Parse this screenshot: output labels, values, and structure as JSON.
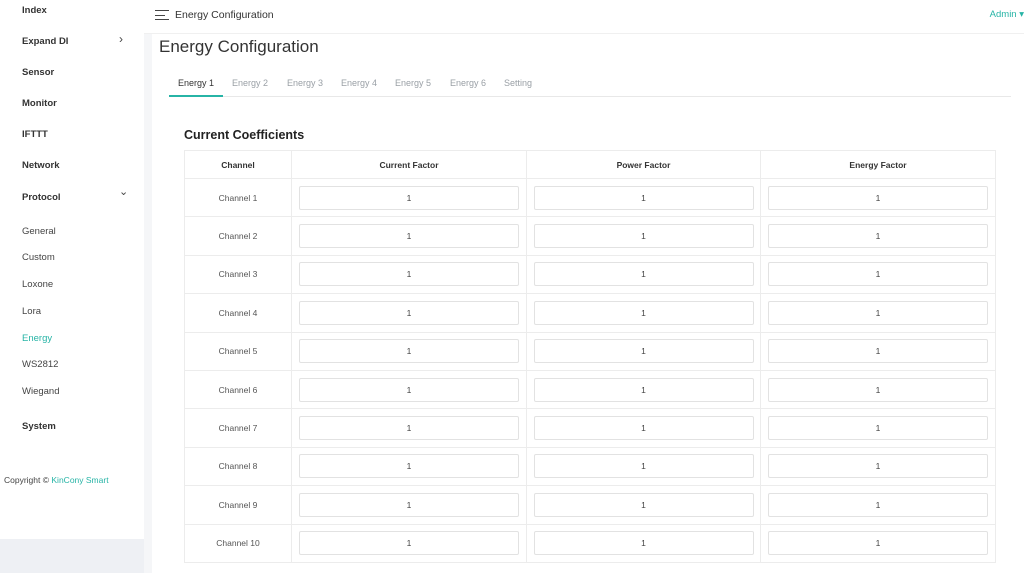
{
  "sidebar": {
    "items": [
      {
        "label": "Index"
      },
      {
        "label": "Expand DI",
        "chevron": "›"
      },
      {
        "label": "Sensor"
      },
      {
        "label": "Monitor"
      },
      {
        "label": "IFTTT"
      },
      {
        "label": "Network"
      },
      {
        "label": "Protocol",
        "chevron": "⌄"
      }
    ],
    "protocol_sub": [
      {
        "label": "General"
      },
      {
        "label": "Custom"
      },
      {
        "label": "Loxone"
      },
      {
        "label": "Lora"
      },
      {
        "label": "Energy",
        "active": true
      },
      {
        "label": "WS2812"
      },
      {
        "label": "Wiegand"
      }
    ],
    "system_label": "System",
    "copyright_prefix": "Copyright ©",
    "copyright_brand": "KinCony Smart"
  },
  "header": {
    "title": "Energy Configuration",
    "user": "Admin ▾"
  },
  "main": {
    "page_title": "Energy Configuration",
    "tabs": [
      {
        "label": "Energy 1",
        "active": true
      },
      {
        "label": "Energy 2"
      },
      {
        "label": "Energy 3"
      },
      {
        "label": "Energy 4"
      },
      {
        "label": "Energy 5"
      },
      {
        "label": "Energy 6"
      },
      {
        "label": "Setting"
      }
    ],
    "section_title": "Current Coefficients",
    "table": {
      "headers": [
        "Channel",
        "Current Factor",
        "Power Factor",
        "Energy Factor"
      ],
      "rows": [
        {
          "channel": "Channel 1",
          "current": "1",
          "power": "1",
          "energy": "1"
        },
        {
          "channel": "Channel 2",
          "current": "1",
          "power": "1",
          "energy": "1"
        },
        {
          "channel": "Channel 3",
          "current": "1",
          "power": "1",
          "energy": "1"
        },
        {
          "channel": "Channel 4",
          "current": "1",
          "power": "1",
          "energy": "1"
        },
        {
          "channel": "Channel 5",
          "current": "1",
          "power": "1",
          "energy": "1"
        },
        {
          "channel": "Channel 6",
          "current": "1",
          "power": "1",
          "energy": "1"
        },
        {
          "channel": "Channel 7",
          "current": "1",
          "power": "1",
          "energy": "1"
        },
        {
          "channel": "Channel 8",
          "current": "1",
          "power": "1",
          "energy": "1"
        },
        {
          "channel": "Channel 9",
          "current": "1",
          "power": "1",
          "energy": "1"
        },
        {
          "channel": "Channel 10",
          "current": "1",
          "power": "1",
          "energy": "1"
        }
      ]
    }
  },
  "colors": {
    "accent": "#27b4a6"
  }
}
